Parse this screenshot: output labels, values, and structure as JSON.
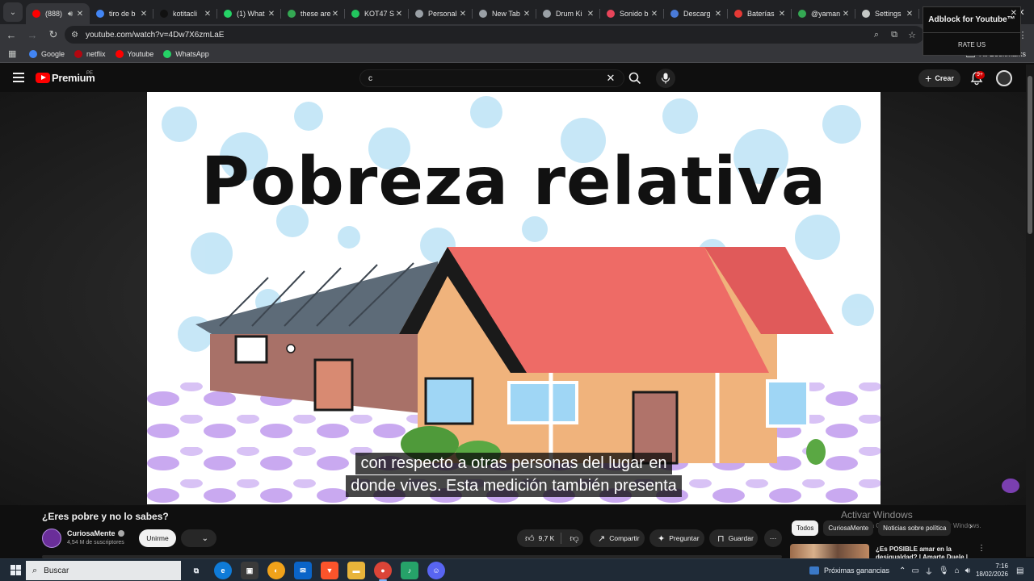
{
  "browser": {
    "tabs": [
      {
        "label": "(888)",
        "favicon_color": "#ff0000",
        "active": true,
        "audio": true
      },
      {
        "label": "tiro de b",
        "favicon_color": "#4285f4"
      },
      {
        "label": "kotitacli",
        "favicon_color": "#111111"
      },
      {
        "label": "(1) What",
        "favicon_color": "#25d366"
      },
      {
        "label": "these are",
        "favicon_color": "#34a853"
      },
      {
        "label": "KOT47 S",
        "favicon_color": "#22c55e"
      },
      {
        "label": "Personal",
        "favicon_color": "#9aa0a6"
      },
      {
        "label": "New Tab",
        "favicon_color": "#9aa0a6"
      },
      {
        "label": "Drum Ki",
        "favicon_color": "#9aa0a6"
      },
      {
        "label": "Sonido b",
        "favicon_color": "#e8455a"
      },
      {
        "label": "Descarg",
        "favicon_color": "#4a7bd9"
      },
      {
        "label": "Baterías",
        "favicon_color": "#e53935"
      },
      {
        "label": "@yaman",
        "favicon_color": "#34a853"
      },
      {
        "label": "Settings",
        "favicon_color": "#c4c7c5"
      }
    ],
    "url": "youtube.com/watch?v=4Dw7X6zmLaE",
    "bookmarks": [
      {
        "label": "Google",
        "color": "#4285f4"
      },
      {
        "label": "netflix",
        "color": "#b20710"
      },
      {
        "label": "Youtube",
        "color": "#ff0000"
      },
      {
        "label": "WhatsApp",
        "color": "#25d366"
      }
    ],
    "all_bookmarks": "All Bookmarks"
  },
  "youtube": {
    "logo_text": "Premium",
    "country_code": "PE",
    "search_query": "c",
    "create_label": "Crear",
    "notifications_badge": "9+",
    "video": {
      "frame_title": "Pobreza relativa",
      "caption_lines": [
        "con respecto a otras personas del lugar en",
        "donde vives. Esta medición también presenta"
      ]
    },
    "adblock": {
      "title": "Adblock for Youtube™",
      "rate": "RATE US"
    },
    "watch": {
      "title": "¿Eres pobre y no lo sabes?",
      "channel": "CuriosaMente",
      "subscribers": "4,54 M de suscriptores",
      "join_label": "Unirme",
      "likes": "9,7 K",
      "share_label": "Compartir",
      "ask_label": "Preguntar",
      "save_label": "Guardar"
    },
    "chips": [
      "Todos",
      "CuriosaMente",
      "Noticias sobre política"
    ],
    "recommendation_title": "¿Es POSIBLE amar en la desigualdad? | Amarte Duele |",
    "activation": {
      "title": "Activar Windows",
      "subtitle": "Ve a Configuración para activar Windows."
    }
  },
  "taskbar": {
    "search_placeholder": "Buscar",
    "news": "Próximas ganancias",
    "time": "7:16",
    "date": "18/02/2026"
  }
}
